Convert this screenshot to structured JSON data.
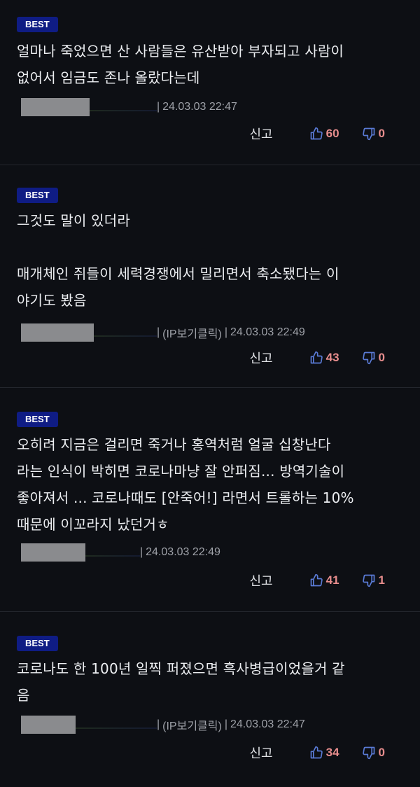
{
  "comments": [
    {
      "badge": "BEST",
      "text": "얼마나 죽었으면 산 사람들은 유산받아 부자되고 사람이\n없어서 임금도 존나 올랐다는데",
      "ip_link": "",
      "timestamp": "24.03.03 22:47",
      "report_label": "신고",
      "likes": "60",
      "dislikes": "0"
    },
    {
      "badge": "BEST",
      "text": "그것도 말이 있더라\n\n매개체인 쥐들이 세력경쟁에서 밀리면서 축소됐다는 이\n야기도 봤음",
      "ip_link": "(IP보기클릭)",
      "timestamp": "24.03.03 22:49",
      "report_label": "신고",
      "likes": "43",
      "dislikes": "0"
    },
    {
      "badge": "BEST",
      "text": "오히려 지금은 걸리면 죽거나 홍역처럼 얼굴 십창난다\n라는 인식이 박히면 코로나마냥 잘 안퍼짐... 방역기술이\n좋아져서 ... 코로나때도 [안죽어!] 라면서 트롤하는 10%\n때문에 이꼬라지 났던거ㅎ",
      "ip_link": "",
      "timestamp": "24.03.03 22:49",
      "report_label": "신고",
      "likes": "41",
      "dislikes": "1"
    },
    {
      "badge": "BEST",
      "text": "코로나도 한 100년 일찍 퍼졌으면 흑사병급이었을거 같\n음",
      "ip_link": "(IP보기클릭)",
      "timestamp": "24.03.03 22:47",
      "report_label": "신고",
      "likes": "34",
      "dislikes": "0"
    }
  ],
  "colors": {
    "background": "#0d0f14",
    "badge_bg": "#0f1c84",
    "vote_count": "#e78d8d",
    "vote_icon": "#5a7bd6"
  },
  "icons": {
    "like": "thumbs-up-icon",
    "dislike": "thumbs-down-icon"
  }
}
